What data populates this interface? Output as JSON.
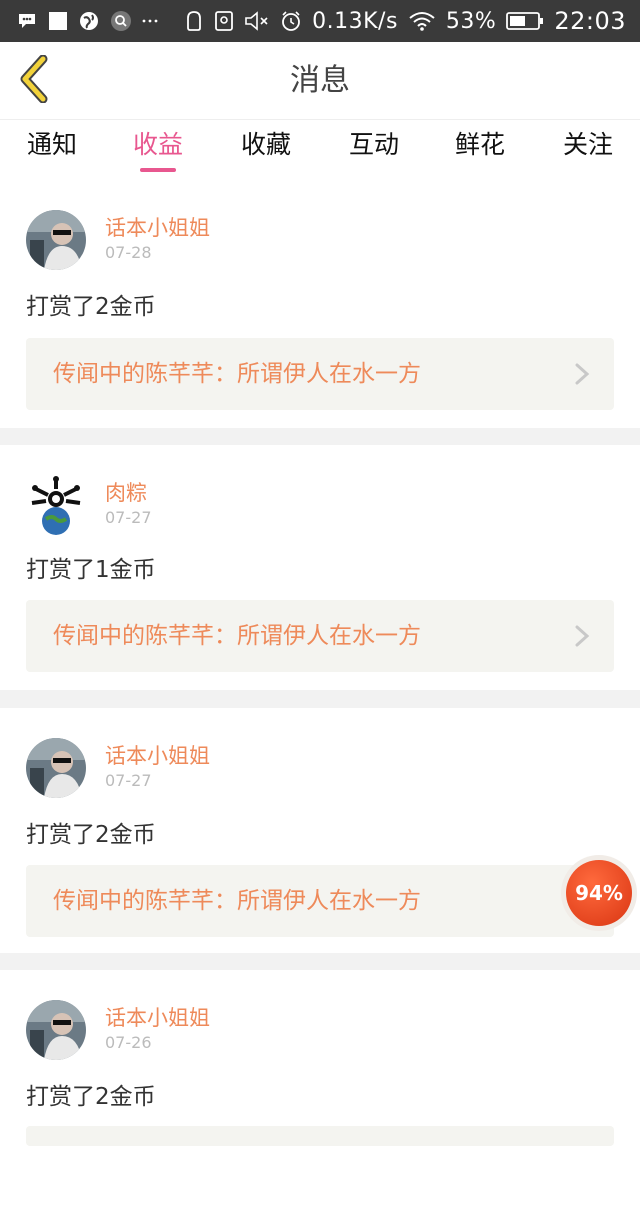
{
  "status_bar": {
    "speed": "0.13K/s",
    "battery": "53%",
    "time": "22:03",
    "icons": [
      "chat-bubble-icon",
      "square-icon",
      "globe-icon",
      "search-icon",
      "more-icon",
      "bag-icon",
      "nfc-icon",
      "mute-icon",
      "alarm-icon",
      "wifi-icon",
      "battery-icon"
    ]
  },
  "header": {
    "title": "消息",
    "back_icon": "chevron-left-icon",
    "accent_color": "#f2d23a"
  },
  "tabs": {
    "active_index": 1,
    "active_color": "#e8578f",
    "items": [
      {
        "label": "通知"
      },
      {
        "label": "收益"
      },
      {
        "label": "收藏"
      },
      {
        "label": "互动"
      },
      {
        "label": "鲜花"
      },
      {
        "label": "关注"
      }
    ]
  },
  "feed": [
    {
      "user": "话本小姐姐",
      "date": "07-28",
      "text": "打赏了2金币",
      "book": "传闻中的陈芊芊：所谓伊人在水一方",
      "avatar": "person-photo-avatar"
    },
    {
      "user": "肉粽",
      "date": "07-27",
      "text": "打赏了1金币",
      "book": "传闻中的陈芊芊：所谓伊人在水一方",
      "avatar": "earth-bones-avatar"
    },
    {
      "user": "话本小姐姐",
      "date": "07-27",
      "text": "打赏了2金币",
      "book": "传闻中的陈芊芊：所谓伊人在水一方",
      "avatar": "person-photo-avatar"
    },
    {
      "user": "话本小姐姐",
      "date": "07-26",
      "text": "打赏了2金币",
      "book": "",
      "avatar": "person-photo-avatar"
    }
  ],
  "floating_badge": {
    "label": "94%",
    "color": "#e5401a"
  },
  "colors": {
    "username": "#ee8a5a",
    "book_title": "#ee8a5a",
    "date": "#bbbbbb",
    "card_link_bg": "#f4f4f0",
    "separator": "#f2f2f2"
  }
}
